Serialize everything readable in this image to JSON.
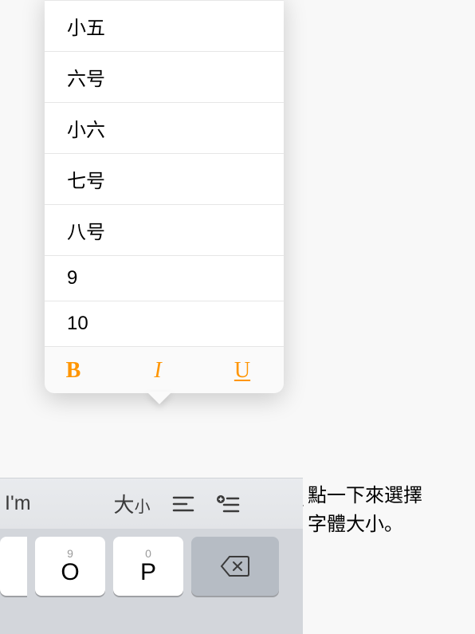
{
  "popover": {
    "sizes": [
      "小五",
      "六号",
      "小六",
      "七号",
      "八号",
      "9",
      "10"
    ],
    "bold_label": "B",
    "italic_label": "I",
    "underline_label": "U"
  },
  "shortcut_bar": {
    "suggestion": "I'm",
    "size_label_big": "大",
    "size_label_small": "小"
  },
  "keyboard": {
    "key_o_sub": "9",
    "key_o_main": "O",
    "key_p_sub": "0",
    "key_p_main": "P"
  },
  "callout": {
    "line1": "點一下來選擇",
    "line2": "字體大小。"
  }
}
